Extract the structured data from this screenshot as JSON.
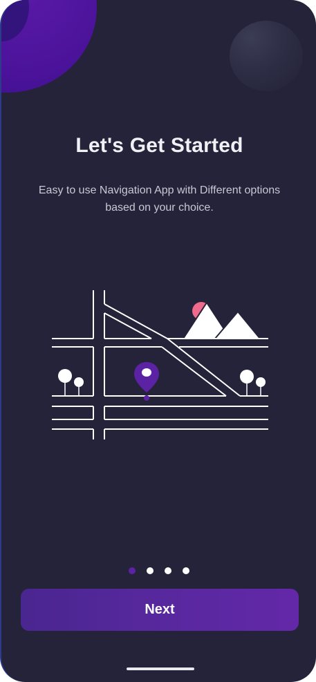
{
  "screen": {
    "title": "Let's Get Started",
    "subtitle": "Easy to use Navigation App with Different options based on your choice."
  },
  "illustration": {
    "icons": [
      "map-roads-illustration",
      "map-pin-icon",
      "mountain-icon",
      "sun-icon",
      "tree-icon"
    ],
    "accent_color": "#5c22a4",
    "sun_color": "#f06a8c"
  },
  "pagination": {
    "total": 4,
    "active_index": 0
  },
  "actions": {
    "next_label": "Next"
  },
  "colors": {
    "background": "#25233a",
    "primary": "#5a28a0",
    "text": "#f1f1f5"
  }
}
